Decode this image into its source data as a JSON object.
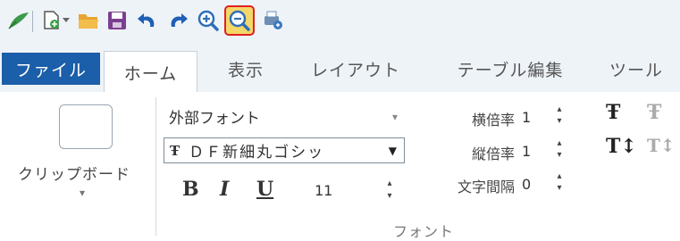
{
  "quick_access": {
    "buttons": [
      {
        "name": "brush-icon"
      },
      {
        "name": "new-document-icon"
      },
      {
        "name": "open-folder-icon"
      },
      {
        "name": "save-icon"
      },
      {
        "name": "undo-icon"
      },
      {
        "name": "redo-icon"
      },
      {
        "name": "zoom-in-icon"
      },
      {
        "name": "zoom-out-icon",
        "highlighted": true
      },
      {
        "name": "print-settings-icon"
      }
    ]
  },
  "tabs": {
    "file": "ファイル",
    "home": "ホーム",
    "view": "表示",
    "layout": "レイアウト",
    "table_edit": "テーブル編集",
    "tools": "ツール"
  },
  "clipboard": {
    "label": "クリップボード"
  },
  "font": {
    "font_type": "外部フォント",
    "font_name": "ＤＦ新細丸ゴシッ",
    "font_name_glyph": "Ŧ",
    "bold": "B",
    "italic": "I",
    "underline": "U",
    "size": "11",
    "h_scale_label": "横倍率",
    "h_scale_value": "1",
    "v_scale_label": "縦倍率",
    "v_scale_value": "1",
    "spacing_label": "文字間隔",
    "spacing_value": "0",
    "group_label": "フォント"
  },
  "colors": {
    "file_tab": "#1b5ea9",
    "highlight_border": "#e02020",
    "highlight_fill": "#f4d769"
  }
}
